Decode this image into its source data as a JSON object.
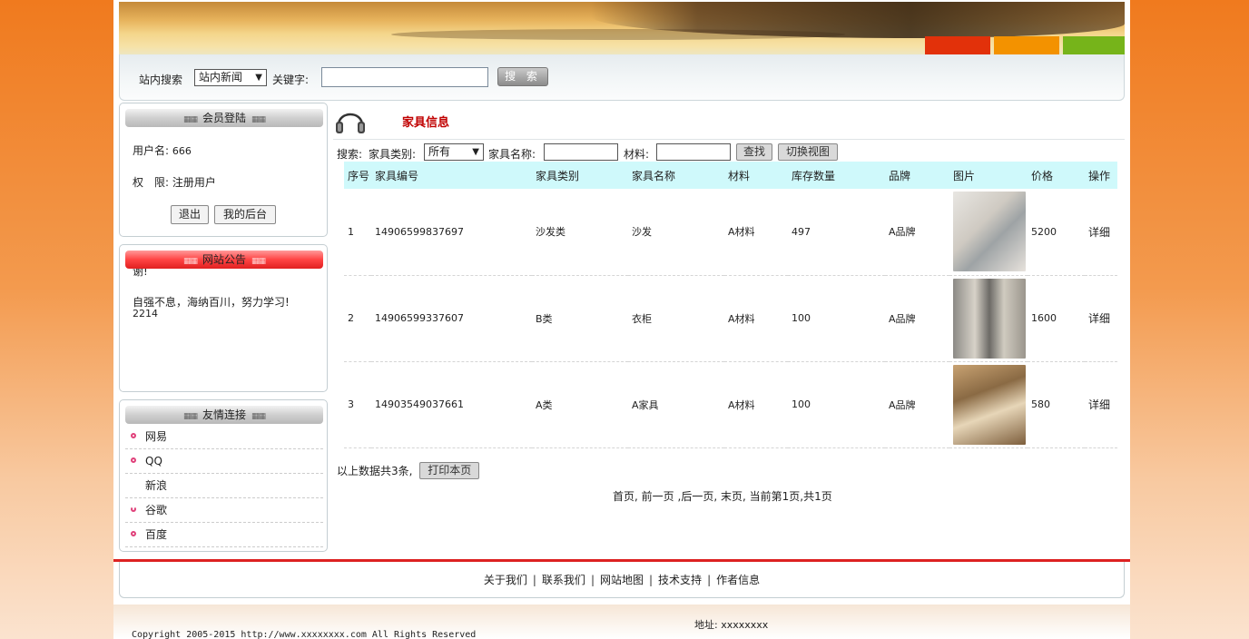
{
  "search": {
    "label": "站内搜索",
    "scope_selected": "站内新闻",
    "keyword_label": "关键字:",
    "keyword_value": "",
    "button": "搜 索"
  },
  "member": {
    "title": "会员登陆",
    "username_label": "用户名:",
    "username": "666",
    "role_label": "权　限:",
    "role": "注册用户",
    "logout": "退出",
    "backend": "我的后台"
  },
  "notice": {
    "title": "网站公告",
    "line_partial": "谢!",
    "line": "自强不息，海纳百川，努力学习!",
    "count": "2214"
  },
  "links": {
    "title": "友情连接",
    "items": [
      "网易",
      "QQ",
      "新浪",
      "谷歌",
      "百度"
    ]
  },
  "main": {
    "title": "家具信息",
    "filter": {
      "search_label": "搜索:",
      "type_label": "家具类别:",
      "type_selected": "所有",
      "name_label": "家具名称:",
      "material_label": "材料:",
      "find_button": "查找",
      "switch_button": "切换视图"
    },
    "columns": [
      "序号",
      "家具编号",
      "家具类别",
      "家具名称",
      "材料",
      "库存数量",
      "品牌",
      "图片",
      "价格",
      "操作"
    ],
    "rows": [
      {
        "no": "1",
        "code": "14906599837697",
        "type": "沙发类",
        "name": "沙发",
        "material": "A材料",
        "stock": "497",
        "brand": "A品牌",
        "price": "5200",
        "action": "详细"
      },
      {
        "no": "2",
        "code": "14906599337607",
        "type": "B类",
        "name": "衣柜",
        "material": "A材料",
        "stock": "100",
        "brand": "A品牌",
        "price": "1600",
        "action": "详细"
      },
      {
        "no": "3",
        "code": "14903549037661",
        "type": "A类",
        "name": "A家具",
        "material": "A材料",
        "stock": "100",
        "brand": "A品牌",
        "price": "580",
        "action": "详细"
      }
    ],
    "summary": "以上数据共3条,",
    "print_button": "打印本页",
    "pager": {
      "first": "首页,",
      "prev": "前一页",
      "next": ",后一页,",
      "last": "末页,",
      "status": "当前第1页,共1页"
    }
  },
  "footer": {
    "nav": [
      "关于我们",
      "联系我们",
      "网站地图",
      "技术支持",
      "作者信息"
    ],
    "separator": "|",
    "address": "地址: xxxxxxxx",
    "copyright": "Copyright 2005-2015 http://www.xxxxxxxx.com All Rights Reserved"
  }
}
